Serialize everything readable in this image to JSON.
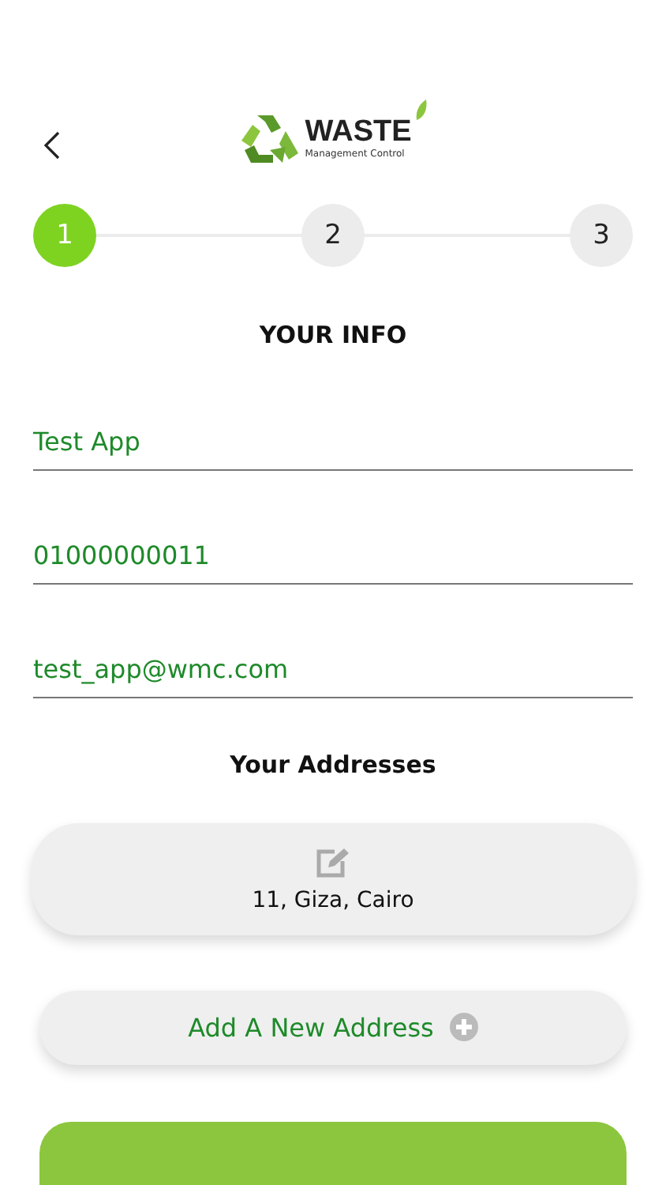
{
  "header": {
    "logo": {
      "title": "WASTE",
      "subtitle": "Management Control"
    }
  },
  "steps": [
    {
      "label": "1",
      "selected": true
    },
    {
      "label": "2",
      "selected": false
    },
    {
      "label": "3",
      "selected": false
    }
  ],
  "section_title": "YOUR INFO",
  "fields": [
    {
      "value": "Test App"
    },
    {
      "value": "01000000011"
    },
    {
      "value": "test_app@wmc.com"
    }
  ],
  "addresses_title": "Your Addresses",
  "addresses": [
    {
      "text": "11, Giza, Cairo"
    }
  ],
  "add_address_button": "Add A New Address"
}
